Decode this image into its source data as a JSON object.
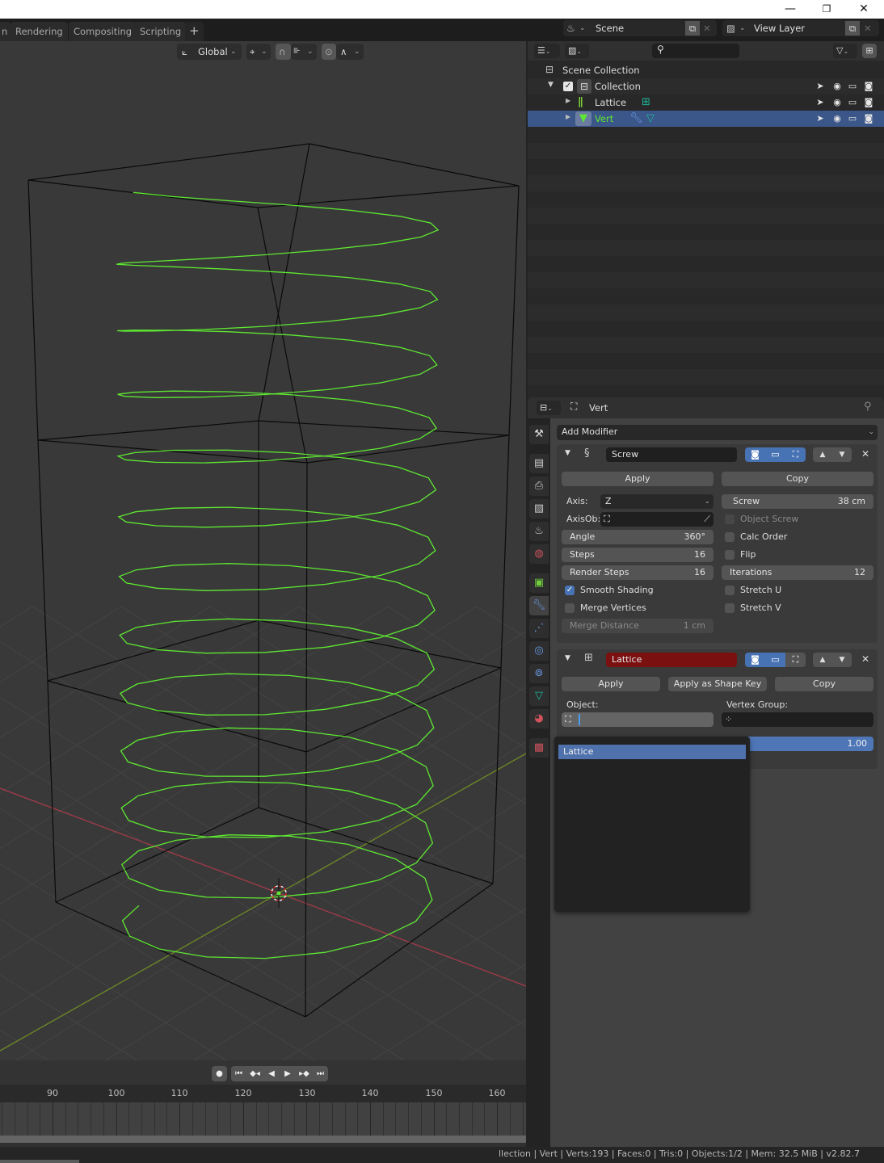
{
  "window": {
    "minimize_icon": "—",
    "restore_icon": "❐",
    "close_icon": "✕"
  },
  "workspace_tabs": [
    {
      "label": "n"
    },
    {
      "label": "Rendering"
    },
    {
      "label": "Compositing"
    },
    {
      "label": "Scripting"
    }
  ],
  "workspace_add": "+",
  "scene_selector": {
    "value": "Scene"
  },
  "view_layer_selector": {
    "value": "View Layer"
  },
  "viewport": {
    "transform_orientation": "Global",
    "colors": {
      "background": "#393939",
      "grid": "#444444",
      "x_axis": "#a33b4a",
      "y_axis": "#6e8a26",
      "lattice": "#0a0a0a",
      "curve": "#5ee832"
    }
  },
  "timeline": {
    "ticks": [
      "90",
      "100",
      "110",
      "120",
      "130",
      "140",
      "150",
      "160"
    ]
  },
  "status": {
    "text": "llection | Vert | Verts:193 | Faces:0 | Tris:0 | Objects:1/2 | Mem: 32.5 MiB | v2.82.7"
  },
  "outliner": {
    "search_placeholder": "",
    "rows": [
      {
        "label": "Scene Collection"
      },
      {
        "label": "Collection"
      },
      {
        "label": "Lattice"
      },
      {
        "label": "Vert"
      }
    ]
  },
  "properties": {
    "object_name": "Vert",
    "add_modifier": "Add Modifier",
    "screw": {
      "name": "Screw",
      "apply": "Apply",
      "copy": "Copy",
      "axis_label": "Axis:",
      "axis_value": "Z",
      "axisob_label": "AxisOb:",
      "angle_label": "Angle",
      "angle_value": "360°",
      "steps_label": "Steps",
      "steps_value": "16",
      "render_steps_label": "Render Steps",
      "render_steps_value": "16",
      "smooth_shading": "Smooth Shading",
      "smooth_shading_checked": true,
      "merge_vertices": "Merge Vertices",
      "merge_vertices_checked": false,
      "merge_distance_label": "Merge Distance",
      "merge_distance_value": "1 cm",
      "screw_label": "Screw",
      "screw_value": "38 cm",
      "object_screw": "Object Screw",
      "calc_order": "Calc Order",
      "flip": "Flip",
      "iterations_label": "Iterations",
      "iterations_value": "12",
      "stretch_u": "Stretch U",
      "stretch_v": "Stretch V"
    },
    "lattice": {
      "name": "Lattice",
      "name_field_color": "#7b1010",
      "apply": "Apply",
      "apply_shape_key": "Apply as Shape Key",
      "copy": "Copy",
      "object_label": "Object:",
      "vertex_group_label": "Vertex Group:",
      "strength_value": "1.00"
    }
  },
  "dropdown": {
    "items": [
      {
        "label": "Lattice"
      }
    ]
  }
}
